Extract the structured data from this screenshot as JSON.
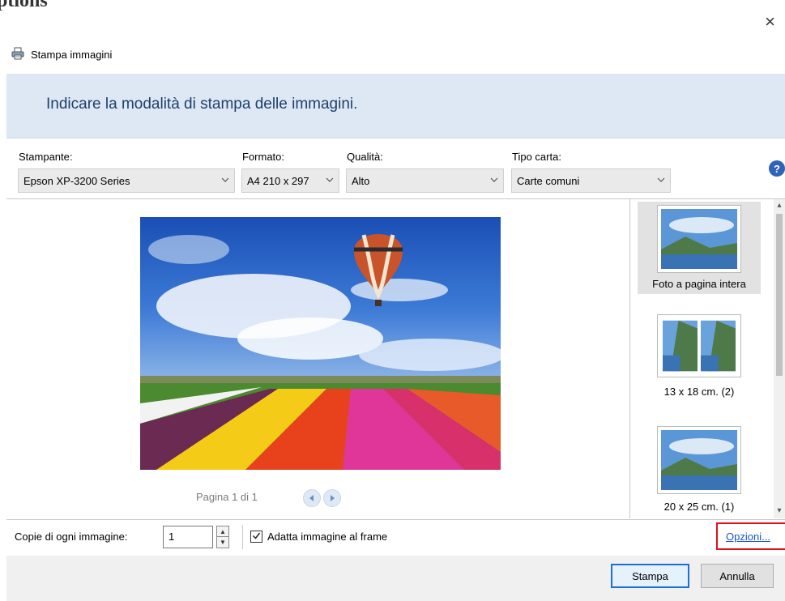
{
  "window": {
    "top_text": "ptions",
    "title": "Stampa immagini",
    "close_glyph": "×",
    "instruction": "Indicare la modalità di stampa delle immagini."
  },
  "settings": {
    "printer_label": "Stampante:",
    "printer_value": "Epson XP-3200 Series",
    "format_label": "Formato:",
    "format_value": "A4 210 x 297",
    "quality_label": "Qualità:",
    "quality_value": "Alto",
    "paper_label": "Tipo carta:",
    "paper_value": "Carte comuni",
    "help_glyph": "?"
  },
  "preview": {
    "page_text": "Pagina 1 di 1"
  },
  "layouts": [
    {
      "label": "Foto a pagina intera"
    },
    {
      "label": "13 x 18 cm. (2)"
    },
    {
      "label": "20 x 25 cm. (1)"
    }
  ],
  "bottom": {
    "copies_label": "Copie di ogni immagine:",
    "copies_value": "1",
    "fit_label": "Adatta immagine al frame",
    "fit_checked": true,
    "options_link": "Opzioni..."
  },
  "footer": {
    "print_button": "Stampa",
    "cancel_button": "Annulla"
  },
  "icons": {
    "title": "printer-icon",
    "close": "close-icon",
    "help": "help-icon",
    "prev": "arrow-left-icon",
    "next": "arrow-right-icon"
  },
  "colors": {
    "banner": "#dde8f4",
    "instruction_text": "#1e3f6b",
    "link": "#1a55c4",
    "highlight": "#e0101a",
    "primary_border": "#1e6fd1"
  }
}
